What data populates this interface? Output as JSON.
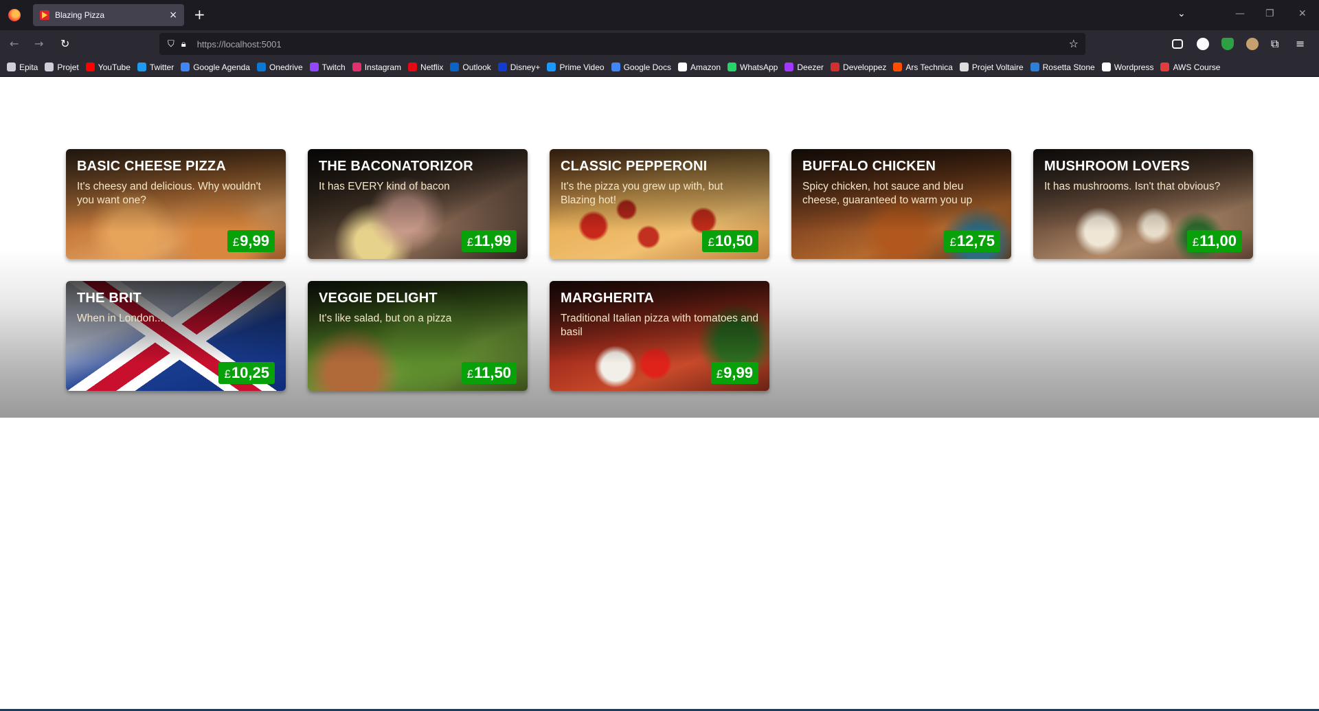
{
  "browser": {
    "tab_title": "Blazing Pizza",
    "tab_close": "×",
    "new_tab": "+",
    "url": "https://localhost:5001"
  },
  "bookmarks": [
    {
      "label": "Epita",
      "color": "#cfcfd8"
    },
    {
      "label": "Projet",
      "color": "#cfcfd8"
    },
    {
      "label": "YouTube",
      "color": "#ff0000"
    },
    {
      "label": "Twitter",
      "color": "#1d9bf0"
    },
    {
      "label": "Google Agenda",
      "color": "#4285f4"
    },
    {
      "label": "Onedrive",
      "color": "#0a78d4"
    },
    {
      "label": "Twitch",
      "color": "#9146ff"
    },
    {
      "label": "Instagram",
      "color": "#e1306c"
    },
    {
      "label": "Netflix",
      "color": "#e50914"
    },
    {
      "label": "Outlook",
      "color": "#0a64c8"
    },
    {
      "label": "Disney+",
      "color": "#113ccf"
    },
    {
      "label": "Prime Video",
      "color": "#1a98ff"
    },
    {
      "label": "Google Docs",
      "color": "#4285f4"
    },
    {
      "label": "Amazon",
      "color": "#ffffff"
    },
    {
      "label": "WhatsApp",
      "color": "#25d366"
    },
    {
      "label": "Deezer",
      "color": "#a238ff"
    },
    {
      "label": "Developpez",
      "color": "#d32f2f"
    },
    {
      "label": "Ars Technica",
      "color": "#ff4e00"
    },
    {
      "label": "Projet Voltaire",
      "color": "#dddddd"
    },
    {
      "label": "Rosetta Stone",
      "color": "#2f7fd8"
    },
    {
      "label": "Wordpress",
      "color": "#ffffff"
    },
    {
      "label": "AWS Course",
      "color": "#e23c3c"
    }
  ],
  "currency_symbol": "£",
  "pizzas": [
    {
      "name": "BASIC CHEESE PIZZA",
      "description": "It's cheesy and delicious. Why wouldn't you want one?",
      "price": "9,99",
      "bg": "radial-gradient(circle at 30% 75%, #e6a35a 0 12%, transparent 25%), radial-gradient(circle at 70% 80%, #d9873f 0 15%, transparent 30%), linear-gradient(160deg, #6b4a2e 0%, #c67b3b 45%, #e0a060 70%, #9a5a2a 100%)"
    },
    {
      "name": "THE BACONATORIZOR",
      "description": "It has EVERY kind of bacon",
      "price": "11,99",
      "bg": "radial-gradient(circle at 45% 60%, #c89a8a 0 12%, transparent 28%), radial-gradient(circle at 30% 85%, #e7d28c 0 10%, transparent 22%), linear-gradient(150deg, #1b1612 0%, #4a3a2c 40%, #8a6a55 65%, #2a221c 100%)"
    },
    {
      "name": "CLASSIC PEPPERONI",
      "description": "It's the pizza you grew up with, but Blazing hot!",
      "price": "10,50",
      "bg": "radial-gradient(circle at 20% 70%, #c8281a 0 6%, transparent 8%), radial-gradient(circle at 45% 80%, #c23020 0 6%, transparent 8%), radial-gradient(circle at 70% 65%, #c22c1a 0 6%, transparent 8%), radial-gradient(circle at 35% 55%, #b8281a 0 5%, transparent 7%), linear-gradient(160deg, #a06030 0%, #e8b05a 40%, #f0c070 70%, #c08040 100%)"
    },
    {
      "name": "BUFFALO CHICKEN",
      "description": "Spicy chicken, hot sauce and bleu cheese, guaranteed to warm you up",
      "price": "12,75",
      "bg": "radial-gradient(circle at 50% 75%, #b0581e 0 15%, transparent 30%), radial-gradient(circle at 85% 85%, #2e6a80 0 8%, transparent 18%), linear-gradient(160deg, #3a2416 0%, #8a4a22 45%, #b56a2e 70%, #5a3418 100%)"
    },
    {
      "name": "MUSHROOM LOVERS",
      "description": "It has mushrooms. Isn't that obvious?",
      "price": "11,00",
      "bg": "radial-gradient(circle at 30% 75%, #efe6d6 0 8%, transparent 14%), radial-gradient(circle at 55% 70%, #e8ddca 0 7%, transparent 13%), radial-gradient(circle at 75% 80%, #2e6a2e 0 7%, transparent 14%), linear-gradient(160deg, #2a2420 0%, #7a5a44 45%, #b08a6a 70%, #5a4030 100%)"
    },
    {
      "name": "THE BRIT",
      "description": "When in London...",
      "price": "10,25",
      "bg": "linear-gradient(35deg, transparent 42%, #ffffff 42% 46%, #c8102e 46% 52%, #ffffff 52% 56%, transparent 56%), linear-gradient(-35deg, transparent 40%, #ffffff 40% 45%, #c8102e 45% 53%, #ffffff 53% 58%, transparent 58%), linear-gradient(160deg, #d8dde8 0%, #b0b8cc 35%, #1c3f94 60%, #0e2c7a 100%)"
    },
    {
      "name": "VEGGIE DELIGHT",
      "description": "It's like salad, but on a pizza",
      "price": "11,50",
      "bg": "radial-gradient(circle at 20% 85%, #b06a3a 0 12%, transparent 24%), radial-gradient(circle at 55% 55%, #5c8c2c 0 20%, transparent 40%), linear-gradient(160deg, #1e2a14 0%, #4e7a22 40%, #6e9a38 65%, #3a4e1a 100%)"
    },
    {
      "name": "MARGHERITA",
      "description": "Traditional Italian pizza with tomatoes and basil",
      "price": "9,99",
      "bg": "radial-gradient(circle at 48% 75%, #e0231a 0 9%, transparent 12%), radial-gradient(circle at 30% 78%, #f2efe8 0 8%, transparent 12%), radial-gradient(circle at 85% 55%, #2e6e22 0 10%, transparent 20%), linear-gradient(160deg, #3a1410 0%, #a8301e 45%, #c84a2a 70%, #6a2214 100%)"
    }
  ]
}
